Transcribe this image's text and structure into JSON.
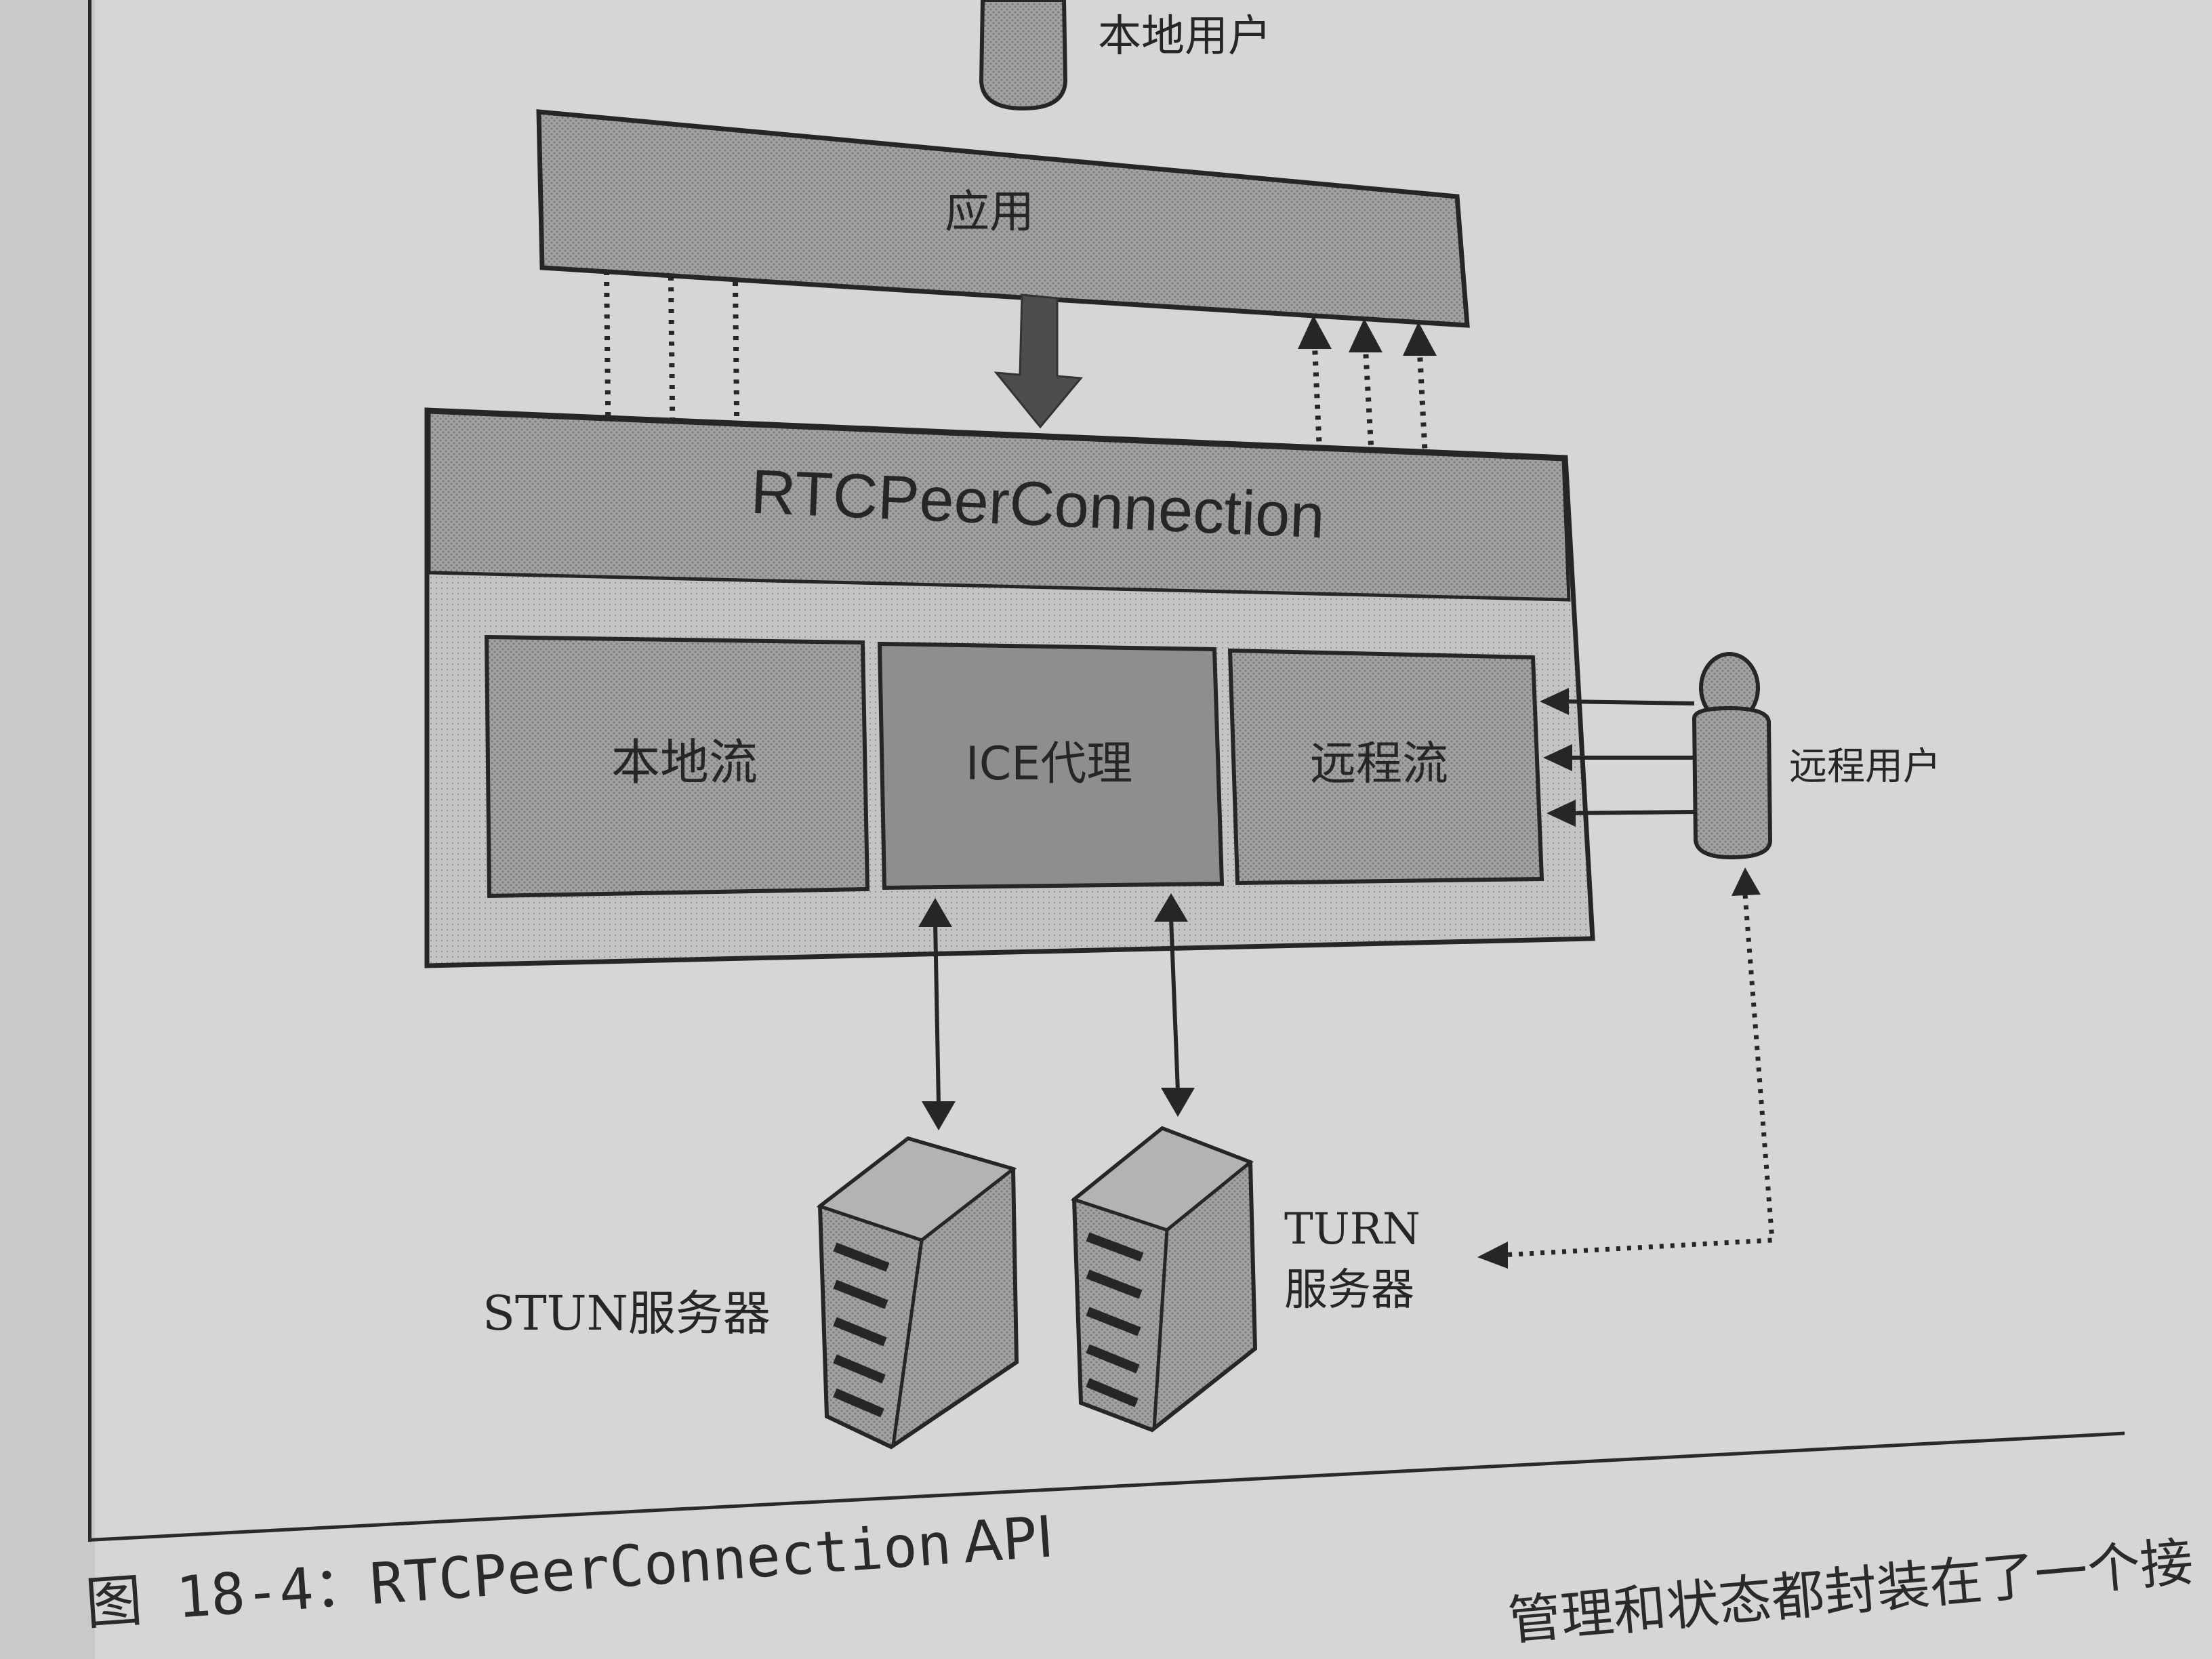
{
  "diagram": {
    "local_user": "本地用户",
    "app": "应用",
    "peer_connection": "RTCPeerConnection",
    "local_stream": "本地流",
    "ice_agent": "ICE代理",
    "remote_stream": "远程流",
    "remote_user": "远程用户",
    "stun_server": "STUN服务器",
    "turn_server_line1": "TURN",
    "turn_server_line2": "服务器"
  },
  "caption": {
    "figure_label": "图",
    "figure_number": "18-4：",
    "title_code": "RTCPeerConnection",
    "title_api": "API"
  },
  "body_text": "管理和状态都封装在了一个接"
}
